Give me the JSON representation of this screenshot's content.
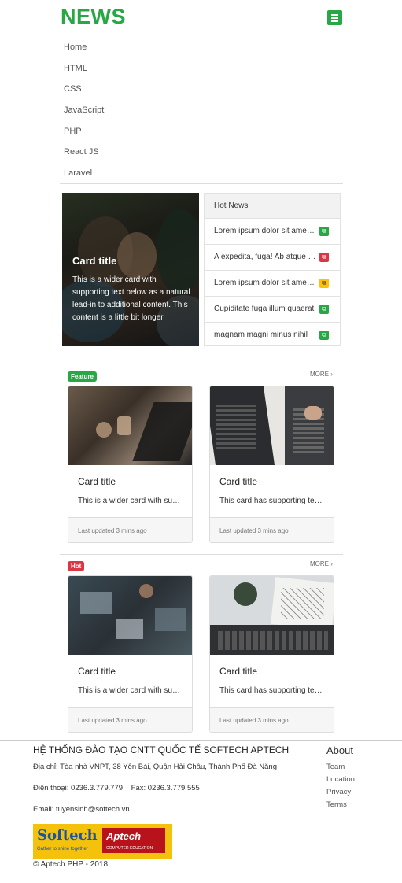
{
  "header": {
    "brand": "NEWS",
    "nav": [
      "Home",
      "HTML",
      "CSS",
      "JavaScript",
      "PHP",
      "React JS",
      "Laravel"
    ]
  },
  "hero": {
    "title": "Card title",
    "text": "This is a wider card with supporting text below as a natural lead-in to additional content. This content is a little bit longer."
  },
  "hot_news": {
    "heading": "Hot News",
    "items": [
      {
        "text": "Lorem ipsum dolor sit amet consectetur",
        "badge_color": "#28a745"
      },
      {
        "text": "A expedita, fuga! Ab atque quas",
        "badge_color": "#dc3545"
      },
      {
        "text": "Lorem ipsum dolor sit amet consectetur",
        "badge_color": "#ffc107"
      },
      {
        "text": "Cupiditate fuga illum quaerat",
        "badge_color": "#28a745"
      },
      {
        "text": "magnam magni minus nihil",
        "badge_color": "#28a745"
      }
    ]
  },
  "sections": [
    {
      "tag": "Feature",
      "tag_color": "#28a745",
      "more": "MORE",
      "cards": [
        {
          "title": "Card title",
          "text": "This is a wider card with supporting text below",
          "footer": "Last updated 3 mins ago"
        },
        {
          "title": "Card title",
          "text": "This card has supporting text below",
          "footer": "Last updated 3 mins ago"
        }
      ]
    },
    {
      "tag": "Hot",
      "tag_color": "#dc3545",
      "more": "MORE",
      "cards": [
        {
          "title": "Card title",
          "text": "This is a wider card with supporting text below",
          "footer": "Last updated 3 mins ago"
        },
        {
          "title": "Card title",
          "text": "This card has supporting text below",
          "footer": "Last updated 3 mins ago"
        }
      ]
    }
  ],
  "footer": {
    "title": "HỆ THỐNG ĐÀO TẠO CNTT QUỐC TẾ SOFTECH APTECH",
    "address": "Địa chỉ: Tòa nhà VNPT, 38 Yên Bái, Quận Hải Châu, Thành Phố Đà Nẵng",
    "phone": "Điện thoại: 0236.3.779.779    Fax: 0236.3.779.555",
    "email": "Email: tuyensinh@softech.vn",
    "logo_left": "Softech",
    "logo_left_sub": "Gather to shine together",
    "logo_right": "Aptech",
    "logo_right_sub": "COMPUTER EDUCATION",
    "copyright": "© Aptech PHP - 2018",
    "about_title": "About",
    "about_links": [
      "Team",
      "Location",
      "Privacy",
      "Terms"
    ]
  }
}
